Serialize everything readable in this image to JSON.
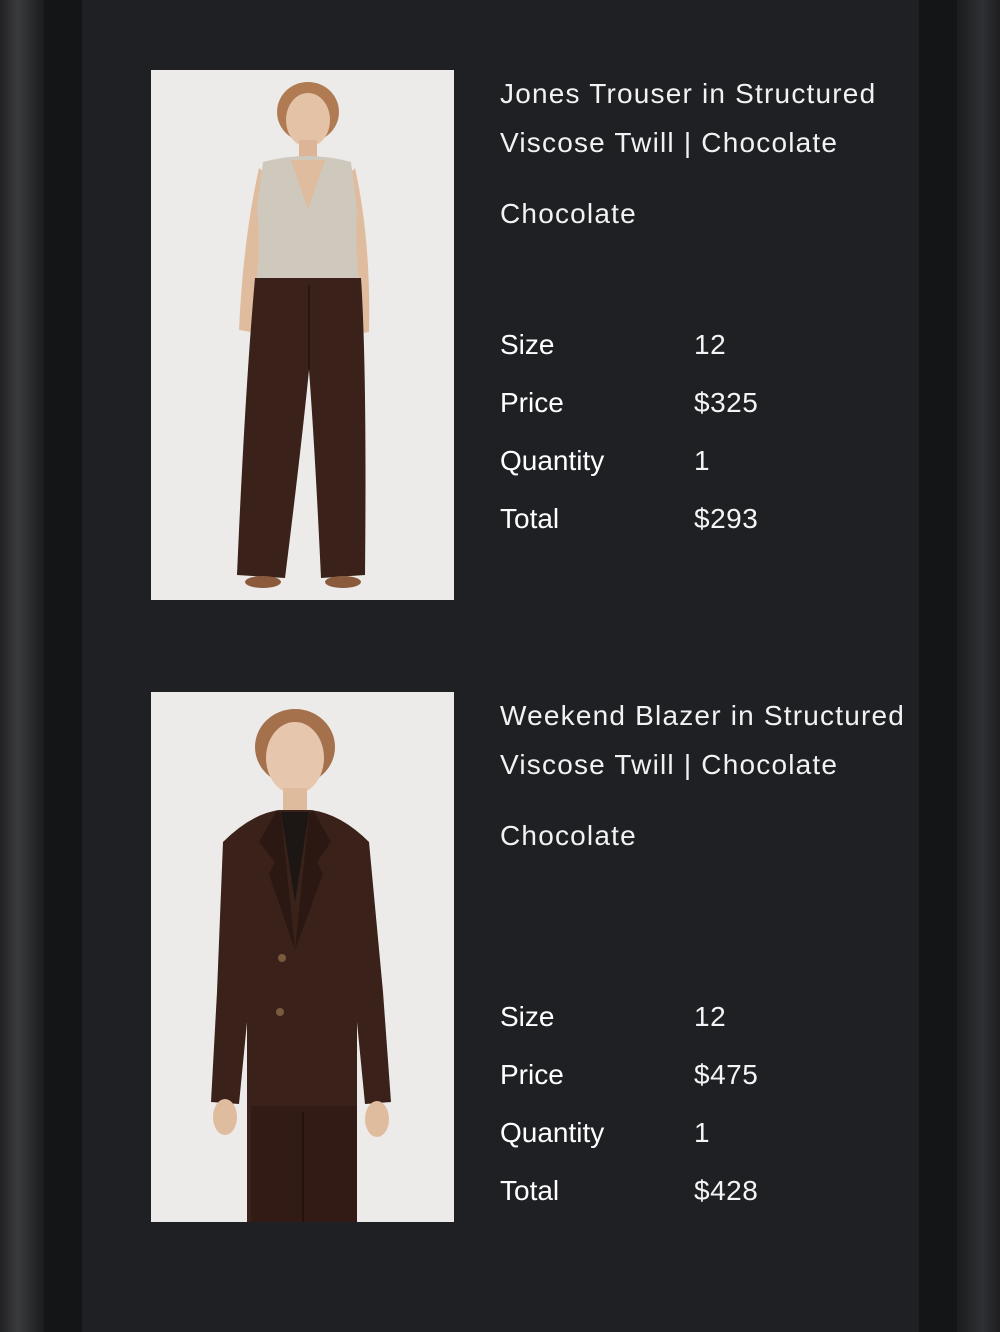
{
  "cart_items": [
    {
      "title": "Jones Trouser in Structured Viscose Twill | Chocolate",
      "color": "Chocolate",
      "image_alt": "Model wearing chocolate wide-leg trousers with sleeveless knit top",
      "details": {
        "size_label": "Size",
        "size_value": "12",
        "price_label": "Price",
        "price_value": "$325",
        "quantity_label": "Quantity",
        "quantity_value": "1",
        "total_label": "Total",
        "total_value": "$293"
      }
    },
    {
      "title": "Weekend Blazer in Structured Viscose Twill | Chocolate",
      "color": "Chocolate",
      "image_alt": "Model wearing chocolate tailored blazer",
      "details": {
        "size_label": "Size",
        "size_value": "12",
        "price_label": "Price",
        "price_value": "$475",
        "quantity_label": "Quantity",
        "quantity_value": "1",
        "total_label": "Total",
        "total_value": "$428"
      }
    }
  ],
  "colors": {
    "panel_bg": "#1f2024",
    "text": "#f2f2f2",
    "photo_bg": "#ecebe9",
    "garment": "#3a2119"
  }
}
